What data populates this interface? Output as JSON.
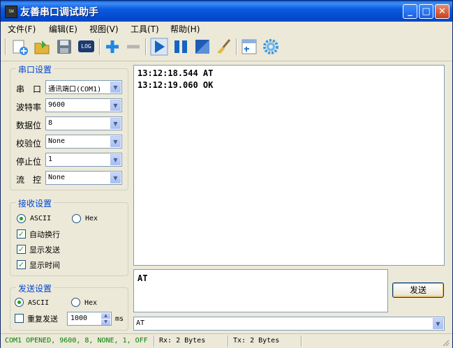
{
  "window": {
    "title": "友善串口调试助手",
    "icon_text": "SW"
  },
  "title_buttons": {
    "minimize": "_",
    "maximize": "□",
    "close": "✕"
  },
  "menu": [
    "文件(F)",
    "编辑(E)",
    "视图(V)",
    "工具(T)",
    "帮助(H)"
  ],
  "toolbar": {
    "log_label": "LOG"
  },
  "serial_settings": {
    "title": "串口设置",
    "rows": [
      {
        "label": "串　口",
        "value": "通讯端口(COM1)"
      },
      {
        "label": "波特率",
        "value": "9600"
      },
      {
        "label": "数据位",
        "value": "8"
      },
      {
        "label": "校验位",
        "value": "None"
      },
      {
        "label": "停止位",
        "value": "1"
      },
      {
        "label": "流　控",
        "value": "None"
      }
    ]
  },
  "receive_settings": {
    "title": "接收设置",
    "ascii": "ASCII",
    "hex": "Hex",
    "auto_wrap": "自动换行",
    "show_send": "显示发送",
    "show_time": "显示时间",
    "check_mark": "✓"
  },
  "send_settings": {
    "title": "发送设置",
    "ascii": "ASCII",
    "hex": "Hex",
    "repeat": "重复发送",
    "interval": "1000",
    "unit": "ms"
  },
  "receive_lines": [
    "13:12:18.544 AT",
    "13:12:19.060 OK"
  ],
  "send_text": "AT",
  "send_button": "发送",
  "history_value": "AT",
  "status": {
    "port": "COM1 OPENED, 9600, 8, NONE, 1, OFF",
    "rx": "Rx: 2 Bytes",
    "tx": "Tx: 2 Bytes"
  },
  "colors": {
    "title_bar": "#0b5be0",
    "group_title": "#0046d5",
    "status_port": "#008000",
    "window_bg": "#ece9d8"
  }
}
